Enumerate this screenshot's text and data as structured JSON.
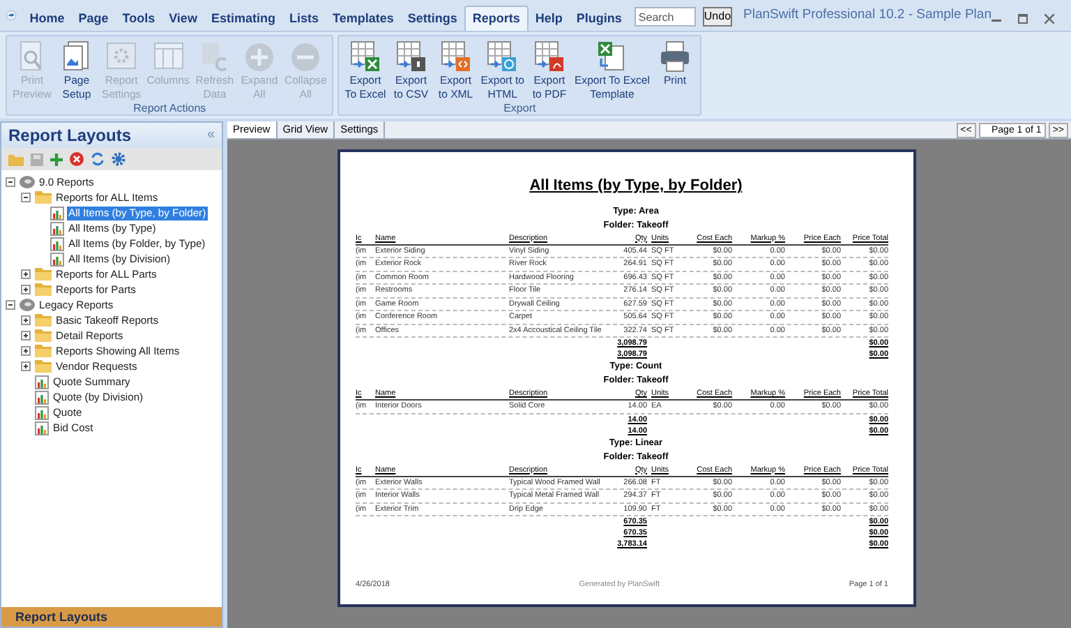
{
  "window": {
    "title": "PlanSwift Professional 10.2 - Sample Plan"
  },
  "menu_tabs": [
    {
      "label": "Home",
      "selected": false
    },
    {
      "label": "Page",
      "selected": false
    },
    {
      "label": "Tools",
      "selected": false
    },
    {
      "label": "View",
      "selected": false
    },
    {
      "label": "Estimating",
      "selected": false
    },
    {
      "label": "Lists",
      "selected": false
    },
    {
      "label": "Templates",
      "selected": false
    },
    {
      "label": "Settings",
      "selected": false
    },
    {
      "label": "Reports",
      "selected": true
    },
    {
      "label": "Help",
      "selected": false
    },
    {
      "label": "Plugins",
      "selected": false
    }
  ],
  "search": {
    "placeholder": "Search"
  },
  "undo_button": "Undo",
  "ribbon_groups": [
    {
      "label": "Report Actions",
      "buttons": [
        {
          "kind": "preview",
          "label": [
            "Print",
            "Preview"
          ],
          "disabled": true
        },
        {
          "kind": "setup",
          "label": [
            "Page",
            "Setup"
          ],
          "disabled": false
        },
        {
          "kind": "settings",
          "label": [
            "Report",
            "Settings"
          ],
          "disabled": true
        },
        {
          "kind": "columns",
          "label": [
            "Columns"
          ],
          "disabled": true
        },
        {
          "kind": "refresh",
          "label": [
            "Refresh",
            "Data"
          ],
          "disabled": true
        },
        {
          "kind": "expand",
          "label": [
            "Expand",
            "All"
          ],
          "disabled": true
        },
        {
          "kind": "collapse",
          "label": [
            "Collapse",
            "All"
          ],
          "disabled": true
        }
      ]
    },
    {
      "label": "Export",
      "buttons": [
        {
          "kind": "excel",
          "label": [
            "Export",
            "To Excel"
          ],
          "disabled": false
        },
        {
          "kind": "csv",
          "label": [
            "Export",
            "to CSV"
          ],
          "disabled": false
        },
        {
          "kind": "xml",
          "label": [
            "Export",
            "to XML"
          ],
          "disabled": false
        },
        {
          "kind": "html",
          "label": [
            "Export to",
            "HTML"
          ],
          "disabled": false
        },
        {
          "kind": "pdf",
          "label": [
            "Export",
            "to PDF"
          ],
          "disabled": false
        },
        {
          "kind": "template",
          "label": [
            "Export To Excel",
            "Template"
          ],
          "disabled": false
        },
        {
          "kind": "print",
          "label": [
            "Print"
          ],
          "disabled": false
        }
      ]
    }
  ],
  "sidebar": {
    "title": "Report Layouts",
    "collapse": "«",
    "bottom_tab": "Report Layouts",
    "tree": [
      {
        "kind": "root",
        "label": "9.0 Reports",
        "expanded": true,
        "children": [
          {
            "kind": "folder",
            "label": "Reports for ALL Items",
            "expanded": true,
            "children": [
              {
                "kind": "report",
                "label": "All Items (by Type, by Folder)",
                "selected": true
              },
              {
                "kind": "report",
                "label": "All Items (by Type)",
                "selected": false
              },
              {
                "kind": "report",
                "label": "All Items (by Folder, by Type)",
                "selected": false
              },
              {
                "kind": "report",
                "label": "All Items (by Division)",
                "selected": false
              }
            ]
          },
          {
            "kind": "folder",
            "label": "Reports for ALL Parts",
            "expanded": false
          },
          {
            "kind": "folder",
            "label": "Reports for Parts",
            "expanded": false
          }
        ]
      },
      {
        "kind": "root",
        "label": "Legacy Reports",
        "expanded": true,
        "children": [
          {
            "kind": "folder",
            "label": "Basic Takeoff Reports",
            "expanded": false
          },
          {
            "kind": "folder",
            "label": "Detail Reports",
            "expanded": false
          },
          {
            "kind": "folder",
            "label": "Reports Showing All Items",
            "expanded": false
          },
          {
            "kind": "folder",
            "label": "Vendor Requests",
            "expanded": false
          },
          {
            "kind": "report",
            "label": "Quote Summary",
            "selected": false
          },
          {
            "kind": "report",
            "label": "Quote (by Division)",
            "selected": false
          },
          {
            "kind": "report",
            "label": "Quote",
            "selected": false
          },
          {
            "kind": "report",
            "label": "Bid Cost",
            "selected": false
          }
        ]
      }
    ]
  },
  "view_tabs": [
    {
      "label": "Preview",
      "selected": true
    },
    {
      "label": "Grid View",
      "selected": false
    },
    {
      "label": "Settings",
      "selected": false
    }
  ],
  "pager": {
    "first": "<<",
    "label": "Page 1 of 1",
    "last": ">>"
  },
  "report": {
    "title": "All Items (by Type, by Folder)",
    "sections": [
      {
        "type": "Type: Area",
        "folder": "Folder: Takeoff",
        "columns": [
          "Ic",
          "Name",
          "Description",
          "Qty",
          "Units",
          "Cost Each",
          "Markup %",
          "Price Each",
          "Price Total"
        ],
        "rows": [
          [
            "(im",
            "Exterior Siding",
            "Vinyl Siding",
            "405.44",
            "SQ FT",
            "$0.00",
            "0.00",
            "$0.00",
            "$0.00"
          ],
          [
            "(im",
            "Exterior Rock",
            "River Rock",
            "264.91",
            "SQ FT",
            "$0.00",
            "0.00",
            "$0.00",
            "$0.00"
          ],
          [
            "(im",
            "Common Room",
            "Hardwood Flooring",
            "696.43",
            "SQ FT",
            "$0.00",
            "0.00",
            "$0.00",
            "$0.00"
          ],
          [
            "(im",
            "Restrooms",
            "Floor Tile",
            "276.14",
            "SQ FT",
            "$0.00",
            "0.00",
            "$0.00",
            "$0.00"
          ],
          [
            "(im",
            "Game Room",
            "Drywall Ceiling",
            "627.59",
            "SQ FT",
            "$0.00",
            "0.00",
            "$0.00",
            "$0.00"
          ],
          [
            "(im",
            "Conference Room",
            "Carpet",
            "505.64",
            "SQ FT",
            "$0.00",
            "0.00",
            "$0.00",
            "$0.00"
          ],
          [
            "(im",
            "Offices",
            "2x4 Accoustical Ceiling Tile",
            "322.74",
            "SQ FT",
            "$0.00",
            "0.00",
            "$0.00",
            "$0.00"
          ]
        ],
        "totals": [
          [
            "3,098.79",
            "$0.00"
          ],
          [
            "3,098.79",
            "$0.00"
          ]
        ]
      },
      {
        "type": "Type: Count",
        "folder": "Folder: Takeoff",
        "columns": [
          "Ic",
          "Name",
          "Description",
          "Qty",
          "Units",
          "Cost Each",
          "Markup %",
          "Price Each",
          "Price Total"
        ],
        "rows": [
          [
            "(im",
            "Interior Doors",
            "Solid Core",
            "14.00",
            "EA",
            "$0.00",
            "0.00",
            "$0.00",
            "$0.00"
          ]
        ],
        "totals": [
          [
            "14.00",
            "$0.00"
          ],
          [
            "14.00",
            "$0.00"
          ]
        ]
      },
      {
        "type": "Type: Linear",
        "folder": "Folder: Takeoff",
        "columns": [
          "Ic",
          "Name",
          "Description",
          "Qty",
          "Units",
          "Cost Each",
          "Markup %",
          "Price Each",
          "Price Total"
        ],
        "rows": [
          [
            "(im",
            "Exterior Walls",
            "Typical Wood Framed Wall",
            "266.08",
            "FT",
            "$0.00",
            "0.00",
            "$0.00",
            "$0.00"
          ],
          [
            "(im",
            "Interior Walls",
            "Typical Metal Framed Wall",
            "294.37",
            "FT",
            "$0.00",
            "0.00",
            "$0.00",
            "$0.00"
          ],
          [
            "(im",
            "Exterior Trim",
            "Drip Edge",
            "109.90",
            "FT",
            "$0.00",
            "0.00",
            "$0.00",
            "$0.00"
          ]
        ],
        "totals": [
          [
            "670.35",
            "$0.00"
          ],
          [
            "670.35",
            "$0.00"
          ],
          [
            "3,783.14",
            "$0.00"
          ]
        ]
      }
    ],
    "footer": {
      "date": "4/26/2018",
      "generated": "Generated by PlanSwift",
      "page": "Page 1 of 1"
    }
  }
}
